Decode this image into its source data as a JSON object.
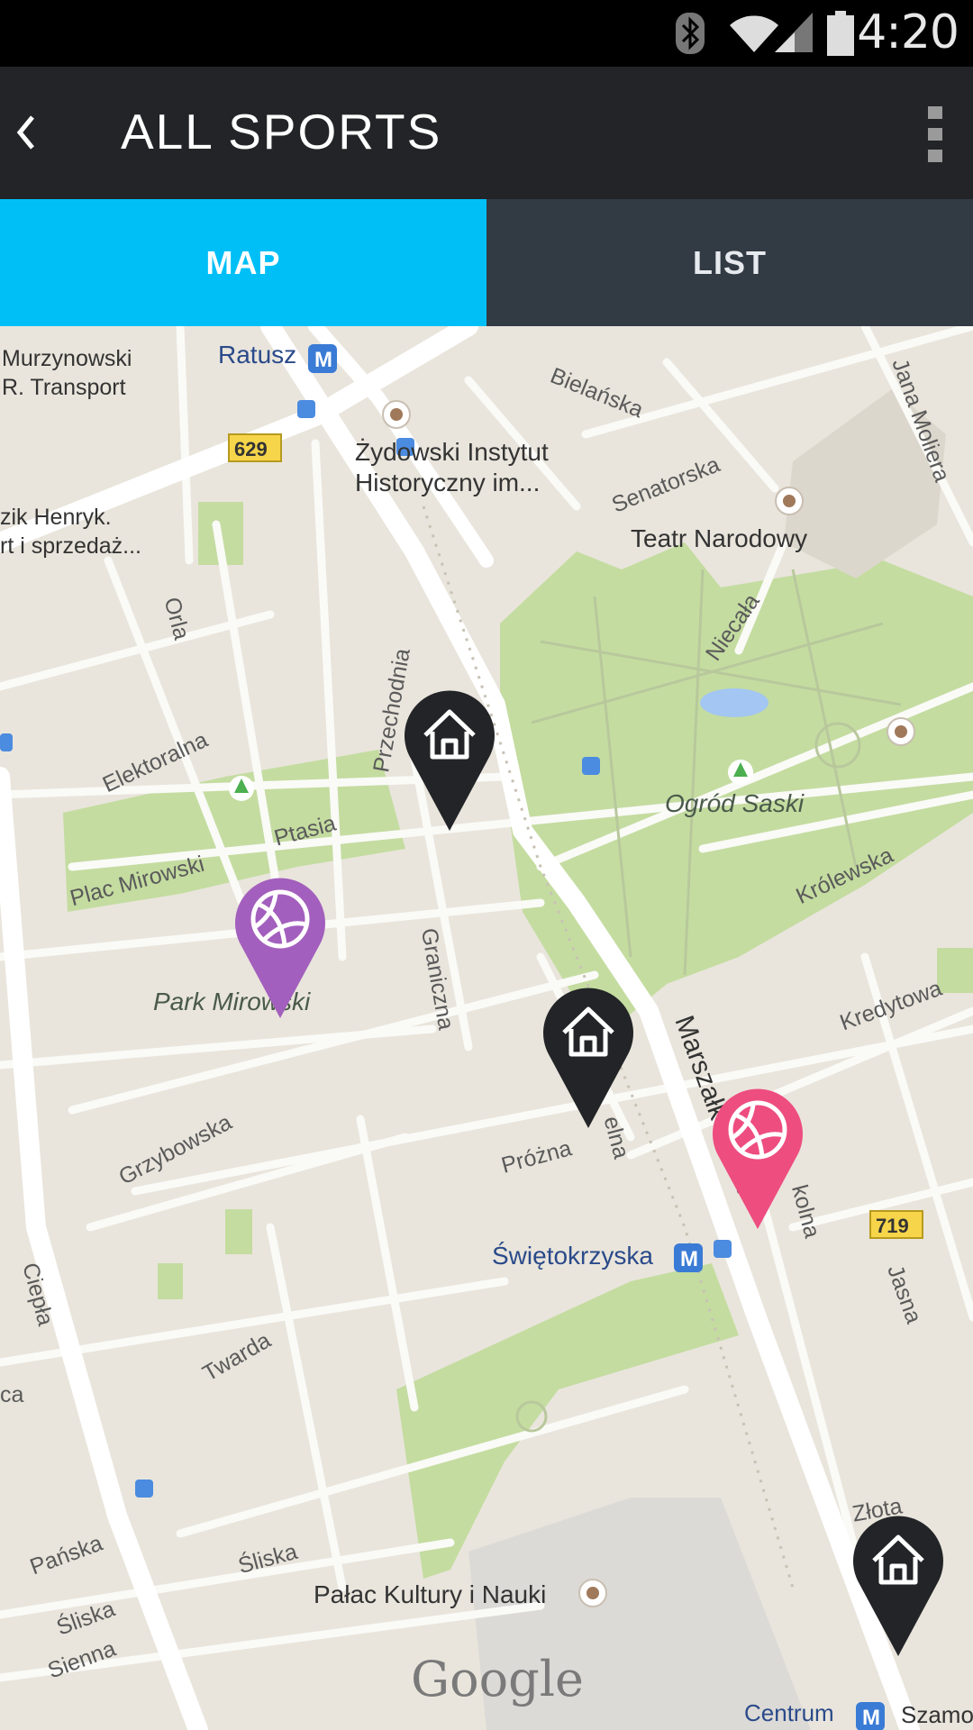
{
  "status_bar": {
    "time": "4:20"
  },
  "app_bar": {
    "title": "ALL SPORTS"
  },
  "tabs": {
    "map": "MAP",
    "list": "LIST"
  },
  "map": {
    "labels": {
      "murzynowski": "Murzynowski",
      "r_transport": "R. Transport",
      "ratusz": "Ratusz",
      "route_629": "629",
      "bielanska": "Bielańska",
      "jana_moliera": "Jana Moliera",
      "zydowski1": "Żydowski Instytut",
      "zydowski2": "Historyczny im...",
      "senatorska": "Senatorska",
      "zik_henryk": "zik Henryk.",
      "rt_sprzedaz": "rt i sprzedaż...",
      "teatr": "Teatr Narodowy",
      "orla": "Orla",
      "niecala": "Niecała",
      "przechodnia": "Przechodnia",
      "elektoralna": "Elektoralna",
      "ogrod_saski": "Ogród Saski",
      "ptasia": "Ptasia",
      "plac_mirowski": "Plac Mirowski",
      "krolewska": "Królewska",
      "graniczna": "Graniczna",
      "park_mirowski": "Park Mirowski",
      "kredytowa": "Kredytowa",
      "marszalkowska": "Marszałkowska",
      "grzybowska": "Grzybowska",
      "prozna": "Próżna",
      "zelna": "elna",
      "szkolna": "kolna",
      "route_719": "719",
      "swietokrzyska": "Świętokrzyska",
      "ciepla": "Ciepła",
      "jasna": "Jasna",
      "ca": "ca",
      "twarda": "Twarda",
      "zlota": "Złota",
      "panska": "Pańska",
      "sliska1": "Śliska",
      "sliska2": "Śliska",
      "sienna": "Sienna",
      "palac": "Pałac Kultury i Nauki",
      "google": "Google",
      "centrum": "Centrum",
      "szamo": "Szamo"
    },
    "pins": [
      {
        "type": "venue",
        "icon": "house-icon",
        "color": "#222427"
      },
      {
        "type": "volleyball",
        "icon": "volleyball-icon",
        "color": "#a35fbd"
      },
      {
        "type": "venue",
        "icon": "house-icon",
        "color": "#222427"
      },
      {
        "type": "volleyball",
        "icon": "volleyball-icon",
        "color": "#ee4d80"
      },
      {
        "type": "venue",
        "icon": "house-icon",
        "color": "#222427"
      }
    ]
  },
  "colors": {
    "accent": "#00bff7",
    "tab_inactive": "#323a44",
    "app_bar": "#222427",
    "park": "#c4dca0",
    "road": "#ffffff",
    "map_bg": "#e9e5dc"
  }
}
